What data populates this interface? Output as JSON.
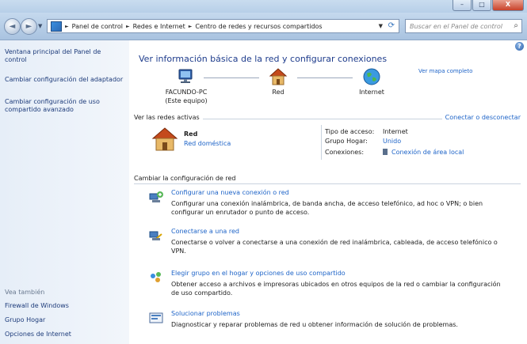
{
  "window": {
    "minimize_symbol": "–",
    "maximize_symbol": "□",
    "close_symbol": "X"
  },
  "nav": {
    "back_symbol": "◄",
    "forward_symbol": "►",
    "dropdown_symbol": "▼",
    "breadcrumbs": [
      "Panel de control",
      "Redes e Internet",
      "Centro de redes y recursos compartidos"
    ],
    "breadcrumb_separator": "►",
    "refresh_symbol": "⟳",
    "search_placeholder": "Buscar en el Panel de control",
    "search_symbol": "⌕"
  },
  "sidebar": {
    "links": [
      "Ventana principal del Panel de control",
      "Cambiar configuración del adaptador",
      "Cambiar configuración de uso compartido avanzado"
    ],
    "see_also_heading": "Vea también",
    "see_also_links": [
      "Firewall de Windows",
      "Grupo Hogar",
      "Opciones de Internet"
    ]
  },
  "main": {
    "help_symbol": "?",
    "title": "Ver información básica de la red y configurar conexiones",
    "map_link": "Ver mapa completo",
    "nodes": {
      "computer_name": "FACUNDO-PC",
      "computer_sub": "(Este equipo)",
      "network": "Red",
      "internet": "Internet"
    },
    "active_networks": {
      "heading": "Ver las redes activas",
      "link": "Conectar o desconectar",
      "name": "Red",
      "type": "Red doméstica",
      "details": [
        {
          "label": "Tipo de acceso:",
          "value": "Internet",
          "link": false
        },
        {
          "label": "Grupo Hogar:",
          "value": "Unido",
          "link": true
        },
        {
          "label": "Conexiones:",
          "value": "Conexión de área local",
          "link": true
        }
      ]
    },
    "change_section": {
      "heading": "Cambiar la configuración de red",
      "tasks": [
        {
          "title": "Configurar una nueva conexión o red",
          "desc": "Configurar una conexión inalámbrica, de banda ancha, de acceso telefónico, ad hoc o VPN; o bien configurar un enrutador o punto de acceso."
        },
        {
          "title": "Conectarse a una red",
          "desc": "Conectarse o volver a conectarse a una conexión de red inalámbrica, cableada, de acceso telefónico o VPN."
        },
        {
          "title": "Elegir grupo en el hogar y opciones de uso compartido",
          "desc": "Obtener acceso a archivos e impresoras ubicados en otros equipos de la red o cambiar la configuración de uso compartido."
        },
        {
          "title": "Solucionar problemas",
          "desc": "Diagnosticar y reparar problemas de red u obtener información de solución de problemas."
        }
      ]
    }
  }
}
